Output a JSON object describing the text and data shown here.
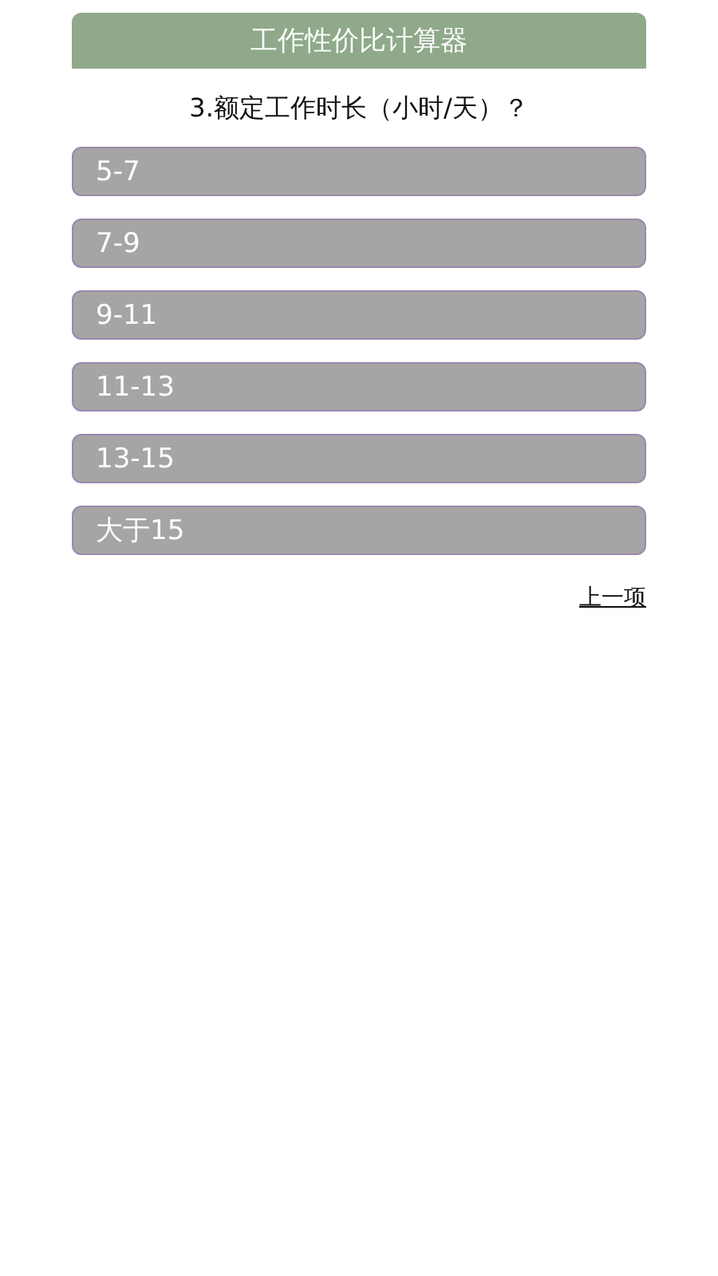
{
  "header": {
    "title": "工作性价比计算器"
  },
  "question": "3.额定工作时长（小时/天）？",
  "options": [
    {
      "label": "5-7"
    },
    {
      "label": "7-9"
    },
    {
      "label": "9-11"
    },
    {
      "label": "11-13"
    },
    {
      "label": "13-15"
    },
    {
      "label": "大于15"
    }
  ],
  "back_link": "上一项"
}
